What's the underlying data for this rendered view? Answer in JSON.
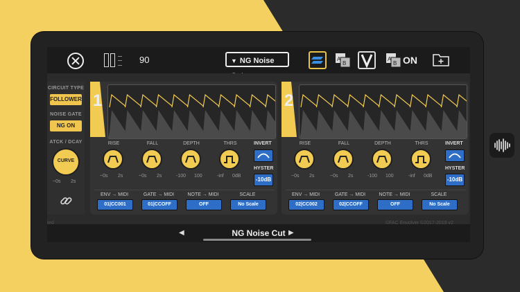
{
  "colors": {
    "accent": "#f2cb52",
    "midi_blue": "#2e6ec7",
    "panel": "#333333",
    "background_dark": "#2b2b2b"
  },
  "toolbar": {
    "close_icon": "close-circle-icon",
    "bpm": "90",
    "preset": "NG Noise Cut",
    "on_label": "ON"
  },
  "sidebar": {
    "circuit_type_label": "CIRCUIT TYPE",
    "circuit_type_value": "FOLLOWER",
    "noise_gate_label": "NOISE GATE",
    "noise_gate_value": "NG ON",
    "atck_dcay_label": "ATCK / DCAY",
    "curve_label": "CURVE",
    "curve_min": "~0s",
    "curve_max": "2s"
  },
  "channels": [
    {
      "number": "1",
      "knobs": [
        {
          "label": "RISE",
          "min": "~0s",
          "max": "2s"
        },
        {
          "label": "FALL",
          "min": "~0s",
          "max": "2s"
        },
        {
          "label": "DEPTH",
          "min": "-100",
          "max": "100"
        },
        {
          "label": "THRS",
          "min": "-inf",
          "max": "0dB"
        }
      ],
      "invert_label": "INVERT",
      "hyster_label": "HYSTER",
      "hyster_value": "-10dB",
      "midi": [
        {
          "label": "ENV → MIDI",
          "value": "01|CC001"
        },
        {
          "label": "GATE → MIDI",
          "value": "01|CCOFF"
        },
        {
          "label": "NOTE → MIDI",
          "value": "OFF"
        },
        {
          "label": "SCALE",
          "value": "No Scale"
        }
      ]
    },
    {
      "number": "2",
      "knobs": [
        {
          "label": "RISE",
          "min": "~0s",
          "max": "2s"
        },
        {
          "label": "FALL",
          "min": "~0s",
          "max": "2s"
        },
        {
          "label": "DEPTH",
          "min": "-100",
          "max": "100"
        },
        {
          "label": "THRS",
          "min": "-inf",
          "max": "0dB"
        }
      ],
      "invert_label": "INVERT",
      "hyster_label": "HYSTER",
      "hyster_value": "-10dB",
      "midi": [
        {
          "label": "ENV → MIDI",
          "value": "02|CC002"
        },
        {
          "label": "GATE → MIDI",
          "value": "02|CCOFF"
        },
        {
          "label": "NOTE → MIDI",
          "value": "OFF"
        },
        {
          "label": "SCALE",
          "value": "No Scale"
        }
      ]
    }
  ],
  "bottom": {
    "preset": "NG Noise Cut",
    "prev": "◀",
    "next": "▶",
    "status": "ted",
    "copyright": "©FAC Envolver ©2017-2019 v2"
  }
}
